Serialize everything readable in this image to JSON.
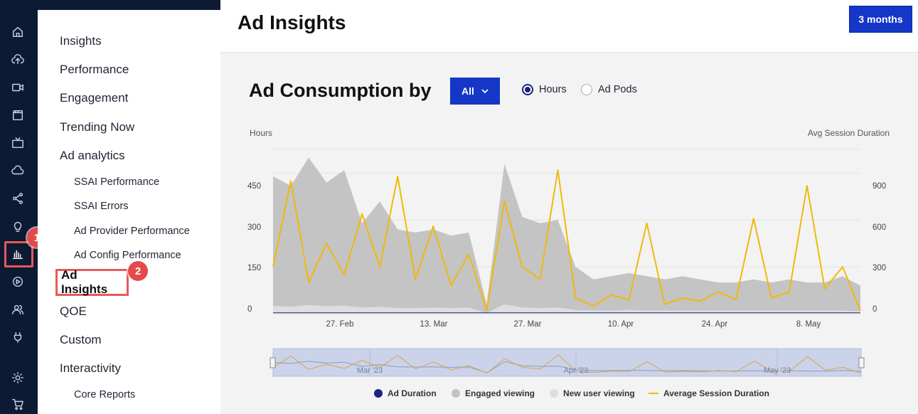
{
  "rail": {
    "icons": [
      "home-icon",
      "upload-icon",
      "video-icon",
      "clapperboard-icon",
      "tv-icon",
      "cloud-icon",
      "share-icon",
      "bulb-icon",
      "analytics-icon",
      "play-circle-icon",
      "users-icon",
      "plug-icon",
      "gear-icon",
      "cart-icon"
    ]
  },
  "annotations": {
    "step1": "1",
    "step2": "2"
  },
  "nav": {
    "items": [
      "Insights",
      "Performance",
      "Engagement",
      "Trending Now",
      "Ad analytics"
    ],
    "ad_sub": [
      "SSAI Performance",
      "SSAI Errors",
      "Ad Provider Performance",
      "Ad Config Performance"
    ],
    "selected": "Ad Insights",
    "after": [
      "QOE",
      "Custom",
      "Interactivity"
    ],
    "interactivity_sub": [
      "Core Reports"
    ]
  },
  "header": {
    "title": "Ad Insights",
    "range_button": "3 months"
  },
  "panel": {
    "title": "Ad Consumption by",
    "filter": "All",
    "radio_hours": "Hours",
    "radio_pods": "Ad Pods",
    "selected_radio": "Hours"
  },
  "chart_data": {
    "type": "area",
    "ylabel": "Hours",
    "y2label": "Avg Session Duration",
    "yticks": [
      "0",
      "150",
      "300",
      "450"
    ],
    "y2ticks": [
      "0",
      "300",
      "600",
      "900"
    ],
    "ylim": [
      0,
      540
    ],
    "y2lim": [
      0,
      1080
    ],
    "xticks": [
      "27. Feb",
      "13. Mar",
      "27. Mar",
      "10. Apr",
      "24. Apr",
      "8. May"
    ],
    "navigator_labels": [
      "Mar '23",
      "Apr '23",
      "May '23"
    ],
    "x_days": [
      0,
      3,
      6,
      9,
      12,
      15,
      18,
      21,
      24,
      27,
      30,
      33,
      36,
      39,
      42,
      45,
      48,
      51,
      54,
      57,
      60,
      63,
      66,
      69,
      72,
      75,
      78,
      81,
      84,
      87,
      90,
      93,
      96,
      99
    ],
    "series": [
      {
        "name": "Ad Duration",
        "color": "#1a237e",
        "values": [
          3,
          3,
          3,
          3,
          3,
          3,
          3,
          3,
          3,
          3,
          3,
          3,
          3,
          3,
          3,
          3,
          3,
          3,
          3,
          3,
          3,
          3,
          3,
          3,
          3,
          3,
          3,
          3,
          3,
          3,
          3,
          3,
          3,
          3
        ]
      },
      {
        "name": "Engaged viewing",
        "color": "#c2c2c2",
        "values": [
          440,
          410,
          500,
          420,
          460,
          290,
          360,
          270,
          260,
          270,
          250,
          260,
          30,
          480,
          310,
          290,
          300,
          150,
          110,
          120,
          130,
          120,
          110,
          120,
          110,
          100,
          100,
          110,
          100,
          110,
          100,
          100,
          120,
          90
        ]
      },
      {
        "name": "New user viewing",
        "color": "#dddddd",
        "values": [
          25,
          22,
          28,
          24,
          26,
          20,
          22,
          18,
          18,
          20,
          18,
          20,
          2,
          30,
          20,
          18,
          20,
          12,
          10,
          10,
          12,
          10,
          10,
          10,
          10,
          10,
          10,
          10,
          10,
          10,
          10,
          10,
          10,
          8
        ]
      },
      {
        "name": "Average Session Duration",
        "color": "#f0b90b",
        "axis": "right",
        "values": [
          300,
          850,
          200,
          450,
          250,
          640,
          300,
          880,
          220,
          560,
          180,
          380,
          20,
          720,
          300,
          220,
          920,
          100,
          50,
          120,
          90,
          580,
          60,
          100,
          80,
          140,
          90,
          610,
          100,
          140,
          820,
          160,
          300,
          20
        ]
      }
    ]
  },
  "legend": [
    "Ad Duration",
    "Engaged viewing",
    "New user viewing",
    "Average Session Duration"
  ]
}
